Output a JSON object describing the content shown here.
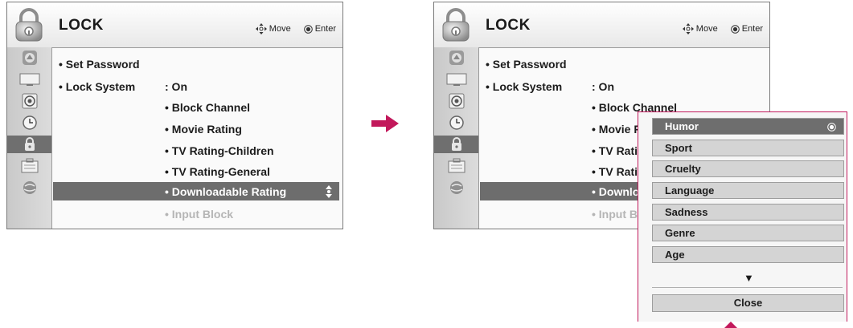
{
  "menu": {
    "title": "LOCK",
    "hint_move": "Move",
    "hint_enter": "Enter",
    "sidebar_icons": [
      "picture-icon",
      "screen-icon",
      "audio-icon",
      "clock-icon",
      "lock-icon",
      "option-icon",
      "globe-icon"
    ],
    "items": {
      "set_password": "• Set Password",
      "lock_system": "• Lock System",
      "lock_system_value": ": On",
      "block_channel": "• Block Channel",
      "movie_rating": "• Movie Rating",
      "tv_rating_children": "• TV Rating-Children",
      "tv_rating_general": "• TV Rating-General",
      "downloadable_rating": "• Downloadable Rating",
      "input_block": "• Input Block"
    },
    "right_truncated": {
      "block_channel": "• Block Channel",
      "movie_rating": "• Movie R",
      "tv_rating_children": "• TV Rati",
      "tv_rating_general": "• TV Rati",
      "downloadable_rating": "• Downlo",
      "input_block": "• Input B"
    }
  },
  "popup": {
    "options": [
      "Humor",
      "Sport",
      "Cruelty",
      "Language",
      "Sadness",
      "Genre",
      "Age"
    ],
    "selected": "Humor",
    "more_indicator": "▼",
    "close_label": "Close"
  },
  "colors": {
    "highlight": "#6d6d6d",
    "accent": "#c2185b"
  }
}
